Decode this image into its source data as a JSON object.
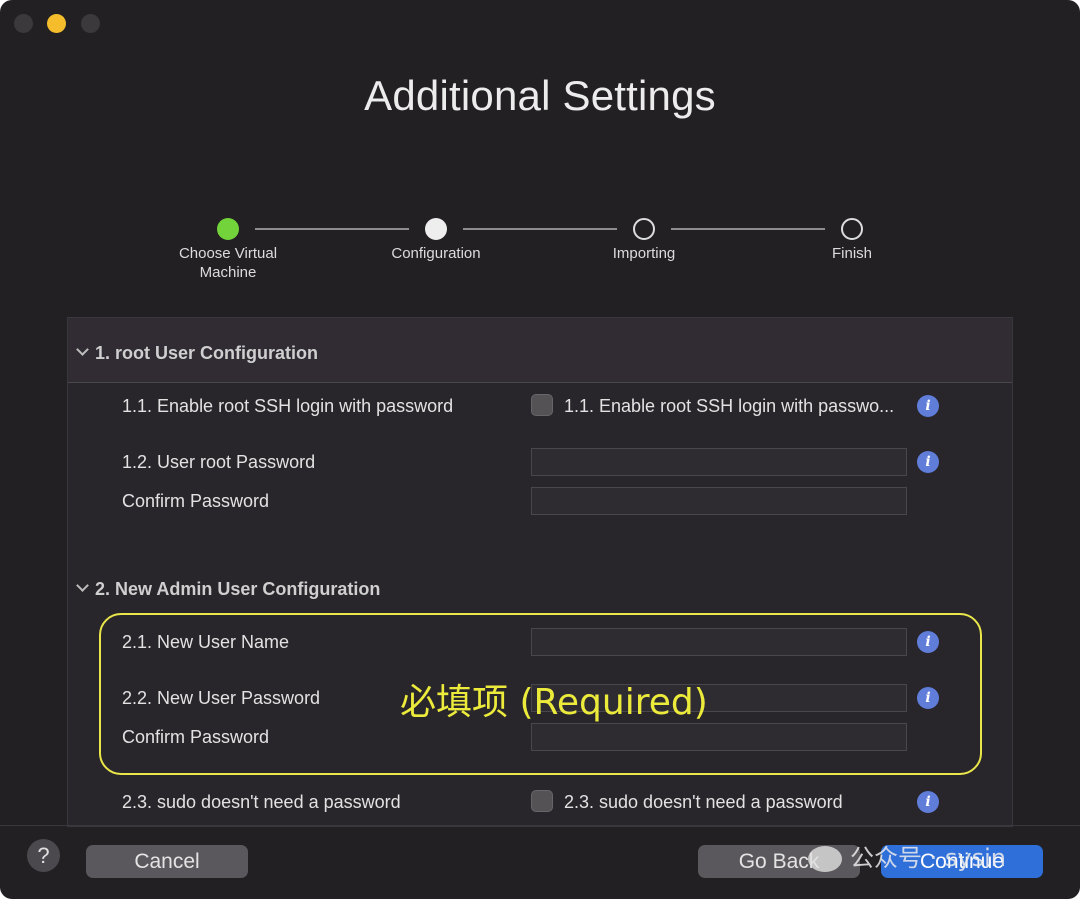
{
  "window": {
    "title": "Additional Settings"
  },
  "stepper": {
    "steps": [
      {
        "label": "Choose Virtual Machine",
        "state": "done"
      },
      {
        "label": "Configuration",
        "state": "current"
      },
      {
        "label": "Importing",
        "state": "future"
      },
      {
        "label": "Finish",
        "state": "future"
      }
    ]
  },
  "sections": [
    {
      "title": "1. root User Configuration",
      "rows": {
        "ssh_label": "1.1. Enable root SSH login with password",
        "ssh_checkbox_label": "1.1. Enable root SSH login with passwo...",
        "ssh_checked": false,
        "root_password_label": "1.2. User root Password",
        "root_password_value": "",
        "confirm_label": "Confirm Password",
        "confirm_value": ""
      }
    },
    {
      "title": "2. New Admin User Configuration",
      "rows": {
        "username_label": "2.1. New User Name",
        "username_value": "",
        "password_label": "2.2. New User Password",
        "password_value": "",
        "confirm_label": "Confirm Password",
        "confirm_value": "",
        "sudo_label": "2.3. sudo doesn't need a password",
        "sudo_checkbox_label": "2.3. sudo doesn't need a password",
        "sudo_checked": false
      }
    }
  ],
  "annotation": {
    "required_note": "必填项 (Required)",
    "highlight_color": "#e9e64a"
  },
  "footer": {
    "help_label": "?",
    "cancel_label": "Cancel",
    "back_label": "Go Back",
    "continue_label": "Continue"
  },
  "watermark": {
    "text": "公众号 · sysin"
  },
  "colors": {
    "accent": "#2f6fd9",
    "step_done": "#72d33b",
    "info_icon": "#5f7dd9"
  }
}
